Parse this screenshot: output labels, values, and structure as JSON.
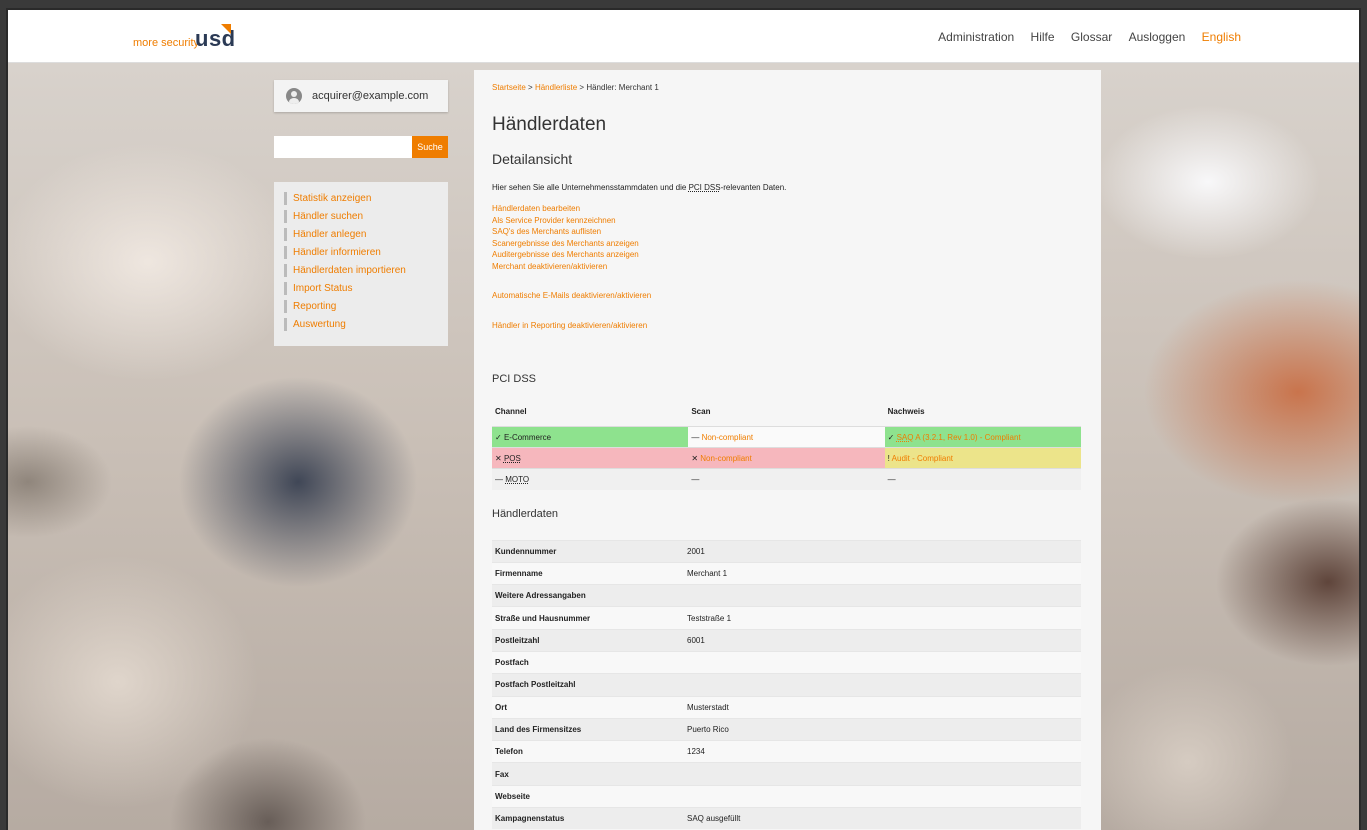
{
  "header": {
    "logo_tagline": "more security.",
    "logo_word": "usd",
    "nav": [
      "Administration",
      "Hilfe",
      "Glossar",
      "Ausloggen"
    ],
    "language": "English"
  },
  "sidebar": {
    "user": "acquirer@example.com",
    "search_placeholder": "",
    "search_button": "Suche",
    "menu": [
      "Statistik anzeigen",
      "Händler suchen",
      "Händler anlegen",
      "Händler informieren",
      "Händlerdaten importieren",
      "Import Status",
      "Reporting",
      "Auswertung"
    ]
  },
  "breadcrumb": {
    "home": "Startseite",
    "sep": ">",
    "list": "Händlerliste",
    "current": "Händler: Merchant 1"
  },
  "main": {
    "title": "Händlerdaten",
    "subtitle": "Detailansicht",
    "intro_pre": "Hier sehen Sie alle Unternehmensstammdaten und die ",
    "intro_abbr": "PCI DSS",
    "intro_post": "-relevanten Daten.",
    "actions": [
      "Händlerdaten bearbeiten",
      "Als Service Provider kennzeichnen",
      "SAQ's des Merchants auflisten",
      "Scanergebnisse des Merchants anzeigen",
      "Auditergebnisse des Merchants anzeigen",
      "Merchant deaktivieren/aktivieren"
    ],
    "action_emails": "Automatische E-Mails deaktivieren/aktivieren",
    "action_reporting": "Händler in Reporting deaktivieren/aktivieren"
  },
  "pci": {
    "heading": "PCI DSS",
    "columns": [
      "Channel",
      "Scan",
      "Nachweis"
    ],
    "rows": [
      {
        "channel_icon": "✓",
        "channel": "E-Commerce",
        "scan_icon": "—",
        "scan": "Non-compliant",
        "proof_icon": "✓",
        "proof_abbr": "SAQ",
        "proof": " A (3.2.1, Rev 1.0) - Compliant"
      },
      {
        "channel_icon": "✕",
        "channel": "POS",
        "scan_icon": "✕",
        "scan": "Non-compliant",
        "proof_icon": "!",
        "proof": "Audit - Compliant"
      },
      {
        "channel_icon": "—",
        "channel": "MOTO",
        "scan_icon": "—",
        "proof_icon": "—"
      }
    ],
    "colors": {
      "ok": "#8ee28e",
      "bad": "#f6b7bd",
      "warn": "#ece48a",
      "accent": "#ef7d00"
    }
  },
  "merchant": {
    "heading": "Händlerdaten",
    "fields": [
      {
        "label": "Kundennummer",
        "value": "2001"
      },
      {
        "label": "Firmenname",
        "value": "Merchant 1"
      },
      {
        "label": "Weitere Adressangaben",
        "value": ""
      },
      {
        "label": "Straße und Hausnummer",
        "value": "Teststraße 1"
      },
      {
        "label": "Postleitzahl",
        "value": "6001"
      },
      {
        "label": "Postfach",
        "value": ""
      },
      {
        "label": "Postfach Postleitzahl",
        "value": ""
      },
      {
        "label": "Ort",
        "value": "Musterstadt"
      },
      {
        "label": "Land des Firmensitzes",
        "value": "Puerto Rico"
      },
      {
        "label": "Telefon",
        "value": "1234"
      },
      {
        "label": "Fax",
        "value": ""
      },
      {
        "label": "Webseite",
        "value": ""
      },
      {
        "label": "Kampagnenstatus",
        "value": "SAQ ausgefüllt"
      }
    ]
  }
}
